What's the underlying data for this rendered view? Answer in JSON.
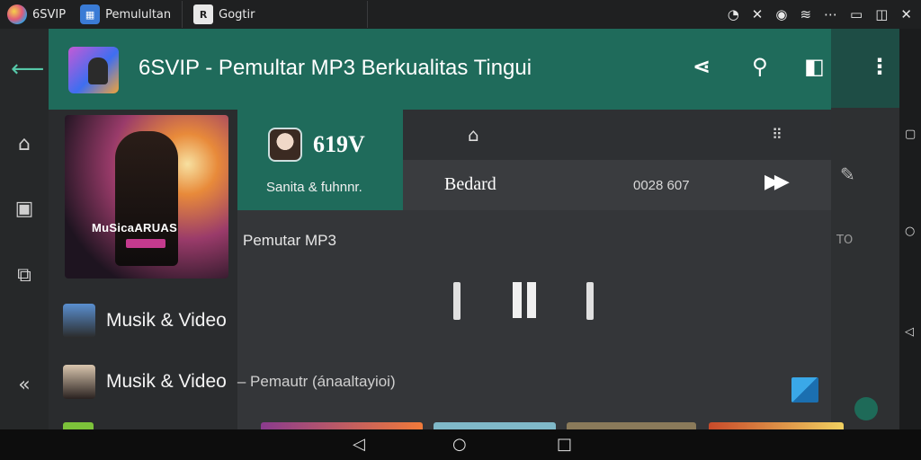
{
  "os_bar": {
    "tabs": [
      {
        "label": "6SVIP",
        "icon": "app-logo-icon"
      },
      {
        "label": "Pemulultan",
        "icon": "store-icon"
      },
      {
        "label": "Gogtir",
        "icon": "doc-icon"
      }
    ],
    "status_icons": [
      "timer-icon",
      "shuffle-icon",
      "record-icon",
      "wifi-icon",
      "more-icon",
      "window-icon",
      "restore-icon",
      "close-icon"
    ]
  },
  "header": {
    "title": "6SVIP - Pemultar MP3 Berkualitas Tingui",
    "actions": [
      "share-icon",
      "search-icon",
      "volume-icon",
      "more-vert-icon"
    ]
  },
  "album": {
    "art_text": "MuSicaARUAS"
  },
  "now_playing": {
    "code": "619V",
    "artist": "Sanita & fuhnnr.",
    "track": "Bedard",
    "time": "0028 607"
  },
  "main": {
    "section_title": "Pemutar MP3"
  },
  "list": [
    {
      "label": "Musik & Video",
      "sub": ""
    },
    {
      "label": "Musik & Video",
      "sub": "– Pemautr (ánaaltayioi)"
    }
  ],
  "ghost": {
    "text": "TO"
  }
}
